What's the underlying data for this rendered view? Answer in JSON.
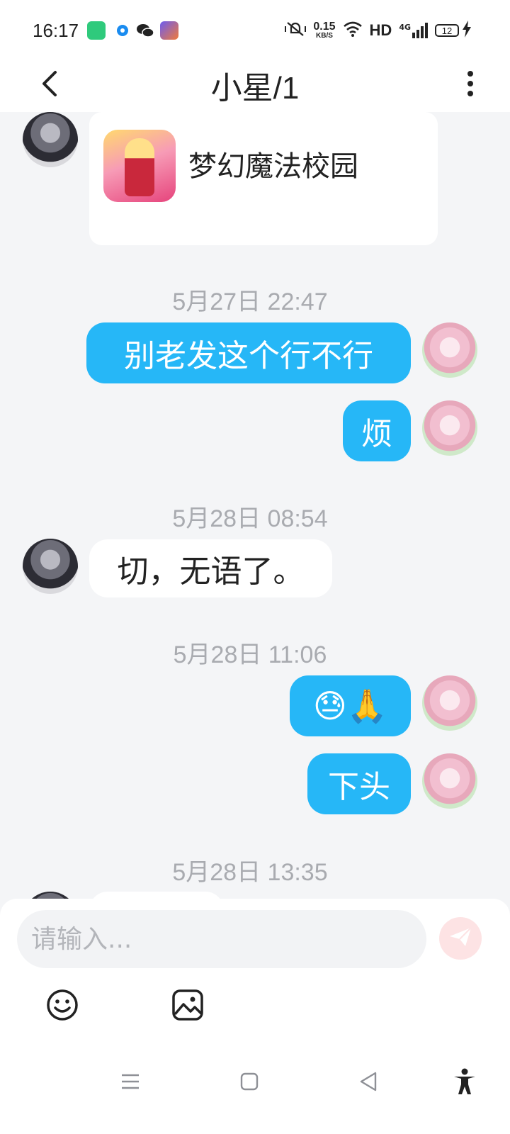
{
  "status_bar": {
    "time": "16:17",
    "net_speed_value": "0.15",
    "net_speed_unit": "KB/S",
    "hd_label": "HD",
    "network_type": "4G",
    "battery_level": "12",
    "app_icon_colors": [
      "#2fca7c",
      "#1a8cf0",
      "#222222",
      "#6c5cf0"
    ]
  },
  "header": {
    "title": "小星/1"
  },
  "chat": {
    "card": {
      "title": "梦幻魔法校园"
    },
    "timestamps": [
      "5月27日 22:47",
      "5月28日 08:54",
      "5月28日 11:06",
      "5月28日 13:35"
    ],
    "messages": [
      {
        "side": "right",
        "text": "别老发这个行不行"
      },
      {
        "side": "right",
        "text": "烦"
      },
      {
        "side": "left",
        "text": "切，无语了。"
      },
      {
        "side": "right",
        "text": "😓🙏"
      },
      {
        "side": "right",
        "text": "下头"
      }
    ]
  },
  "input": {
    "placeholder": "请输入..."
  },
  "icons": {
    "back": "back-arrow-icon",
    "more": "more-vertical-icon",
    "send": "send-icon",
    "emoji": "emoji-icon",
    "image": "image-icon",
    "nav_menu": "menu-icon",
    "nav_home": "home-icon",
    "nav_back": "back-triangle-icon",
    "accessibility": "accessibility-icon"
  },
  "colors": {
    "outgoing_bubble": "#26b7f7",
    "incoming_bubble": "#ffffff",
    "chat_background": "#f4f5f7",
    "timestamp_text": "#a9abb0",
    "send_button_disabled": "#fde3e4"
  }
}
